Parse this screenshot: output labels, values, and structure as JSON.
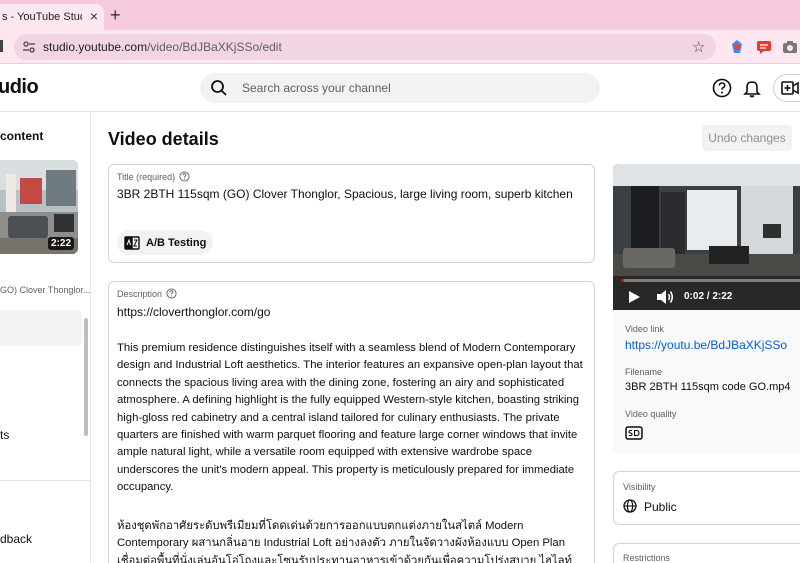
{
  "browser": {
    "tab_title": "s - YouTube Studio",
    "new_tab": "+",
    "close": "×",
    "url_host": "studio.youtube.com",
    "url_path": "/video/BdJBaXKjSSo/edit"
  },
  "header": {
    "logo": "udio",
    "search_placeholder": "Search across your channel"
  },
  "sidebar": {
    "heading": "content",
    "thumb_duration": "2:22",
    "video_title": "GO) Clover Thonglor...",
    "items": [
      "ts",
      "dback"
    ]
  },
  "main": {
    "page_title": "Video details",
    "undo_label": "Undo changes",
    "title_field": {
      "label": "Title (required)",
      "value": "3BR 2BTH 115sqm (GO) Clover Thonglor, Spacious, large living room, superb kitchen"
    },
    "ab_testing": "A/B Testing",
    "description": {
      "label": "Description",
      "link": "https://cloverthonglor.com/go",
      "paragraph": "This premium residence distinguishes itself with a seamless blend of Modern Contemporary design and Industrial Loft aesthetics. The interior features an expansive open-plan layout that connects the spacious living area with the dining zone, fostering an airy and sophisticated atmosphere. A defining highlight is the fully equipped Western-style kitchen, boasting striking high-gloss red cabinetry and a central island tailored for culinary enthusiasts. The private quarters are finished with warm parquet flooring and feature large corner windows that invite ample natural light, while a versatile room equipped with extensive wardrobe space underscores the unit's modern appeal. This property is meticulously prepared for immediate occupancy.",
      "thai": "ห้องชุดพักอาศัยระดับพรีเมียมที่โดดเด่นด้วยการออกแบบตกแต่งภายในสไตล์ Modern Contemporary ผสานกลิ่นอาย Industrial Loft อย่างลงตัว ภายในจัดวางผังห้องแบบ Open Plan เชื่อมต่อพื้นที่นั่งเล่นอันโอ่โถงและโซนรับประทานอาหารเข้าด้วยกันเพื่อความโปร่งสบาย ไฮไลท์สำคัญคือชุดครัวฝรั่งบิ้วท์อินสี"
    }
  },
  "right": {
    "player_time": "0:02 / 2:22",
    "progress": 0.014,
    "video_link_label": "Video link",
    "video_link": "https://youtu.be/BdJBaXKjSSo",
    "filename_label": "Filename",
    "filename": "3BR 2BTH 115sqm code GO.mp4",
    "quality_label": "Video quality",
    "quality_icon": "sd-icon",
    "visibility_label": "Visibility",
    "visibility_value": "Public",
    "restrictions_label": "Restrictions"
  },
  "colors": {
    "tab_bar": "#f6c9dc",
    "link": "#065fd4",
    "progress": "#ff0000"
  }
}
